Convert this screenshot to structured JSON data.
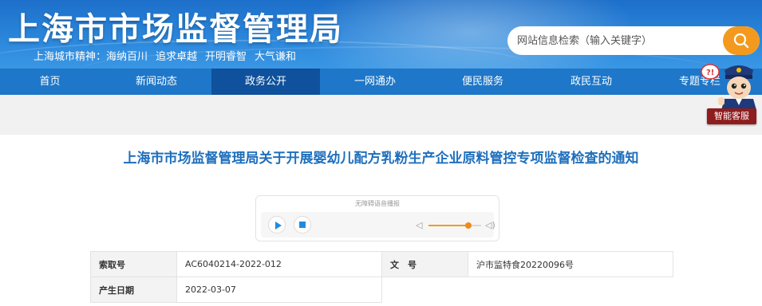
{
  "header": {
    "site_title": "上海市市场监督管理局",
    "slogan": [
      "上海城市精神：海纳百川",
      "追求卓越",
      "开明睿智",
      "大气谦和"
    ],
    "search_placeholder": "网站信息检索（输入关键字）",
    "search_icon": "search-icon"
  },
  "nav": {
    "items": [
      "首页",
      "新闻动态",
      "政务公开",
      "一网通办",
      "便民服务",
      "政民互动",
      "专题专栏"
    ],
    "active": "政务公开"
  },
  "service": {
    "label": "智能客服",
    "bubble": "?!"
  },
  "article": {
    "title": "上海市市场监督管理局关于开展婴幼儿配方乳粉生产企业原料管控专项监督检查的通知"
  },
  "player": {
    "hint": "无障碍语音播报",
    "play_icon": "play-icon",
    "stop_icon": "stop-icon",
    "volume": 0.75
  },
  "meta": {
    "rows": [
      {
        "label1": "索取号",
        "value1": "AC6040214-2022-012",
        "label2": "文　号",
        "value2": "沪市监特食20220096号"
      },
      {
        "label1": "产生日期",
        "value1": "2022-03-07"
      }
    ]
  },
  "colors": {
    "header_blue": "#2a86db",
    "nav_blue": "#1e77c8",
    "nav_active": "#0f519c",
    "accent_orange": "#f39a1e",
    "title_blue": "#1e6fbd"
  }
}
